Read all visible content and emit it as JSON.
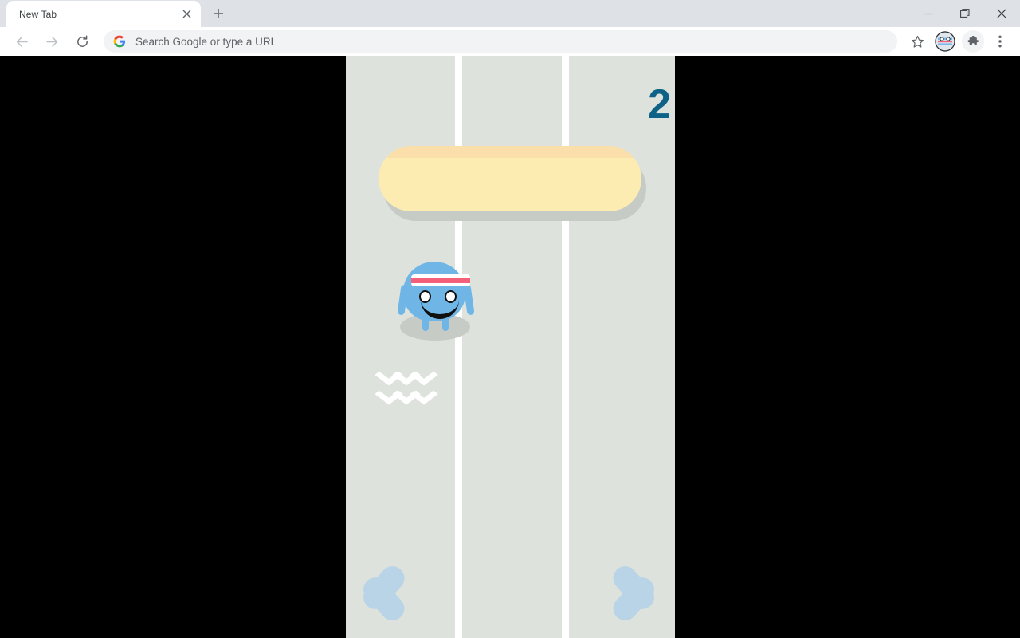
{
  "browser": {
    "tab": {
      "title": "New Tab",
      "close_icon": "close-icon",
      "new_tab_icon": "plus-icon"
    },
    "window_controls": {
      "minimize": "minimize-icon",
      "maximize": "maximize-icon",
      "close": "close-icon"
    },
    "toolbar": {
      "back_icon": "arrow-left-icon",
      "forward_icon": "arrow-right-icon",
      "reload_icon": "reload-icon",
      "bookmark_icon": "star-icon",
      "profile_icon": "avatar-icon",
      "extensions_icon": "puzzle-piece-icon",
      "menu_icon": "three-dots-menu-icon"
    },
    "omnibox": {
      "placeholder": "Search Google or type a URL",
      "value": "",
      "search_engine_icon": "google-g-icon"
    }
  },
  "game": {
    "score": "2",
    "score_color": "#0e6287",
    "background_color": "#dde3dc",
    "lane_divider_color": "#ffffff",
    "lane_count": 3,
    "player": {
      "name": "blue-blob-character",
      "body_color": "#6fb6e6",
      "headband_color": "#ffffff",
      "headband_stripe_color": "#f4607a",
      "shadow_color": "#c6cbc6",
      "lane": 1
    },
    "obstacle": {
      "name": "yellow-platform",
      "fill_color": "#fcecb2",
      "top_highlight_color": "#fadfab",
      "shadow_color": "#c6cbc6"
    },
    "speed_marks": {
      "name": "speed-chevrons",
      "color": "#ffffff",
      "rows": 2,
      "per_row": 3
    },
    "controls": {
      "left_arrow_icon": "chevron-left-icon",
      "right_arrow_icon": "chevron-right-icon",
      "arrow_color": "#b9d4e6"
    }
  }
}
